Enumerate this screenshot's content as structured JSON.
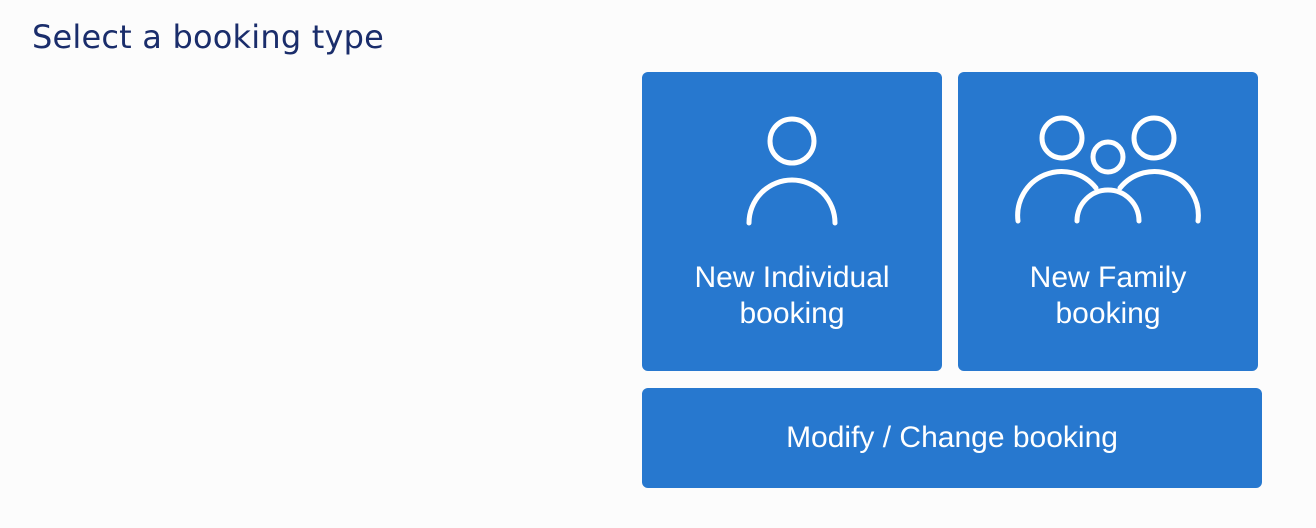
{
  "page": {
    "title": "Select a booking type"
  },
  "options": {
    "individual": {
      "label": "New Individual booking",
      "icon": "person-icon"
    },
    "family": {
      "label": "New Family booking",
      "icon": "family-icon"
    },
    "modify": {
      "label": "Modify / Change booking"
    }
  },
  "colors": {
    "card_background": "#2778cf",
    "title_text": "#1a2d6b",
    "card_text": "#ffffff"
  }
}
